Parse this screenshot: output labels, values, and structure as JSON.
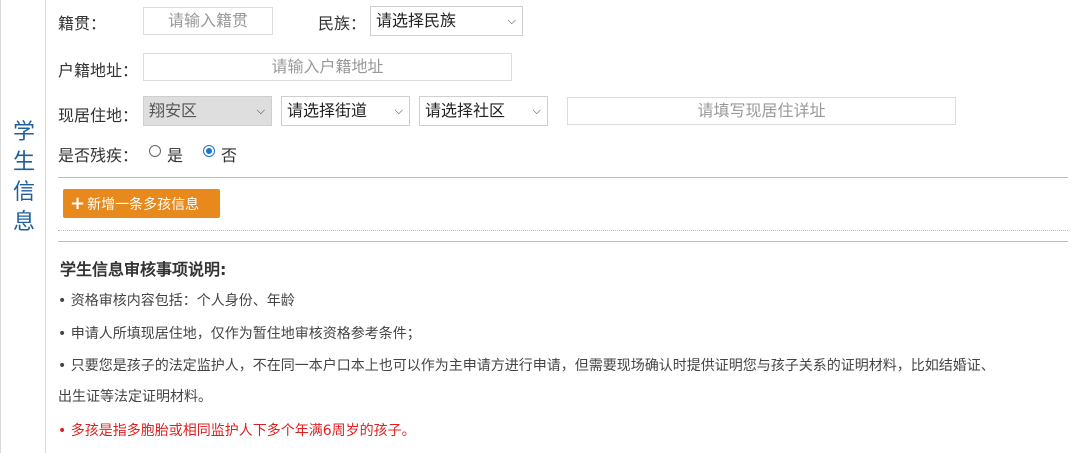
{
  "side": {
    "title_chars": [
      "学",
      "生",
      "信",
      "息"
    ]
  },
  "form": {
    "native_place": {
      "label": "籍贯：",
      "placeholder": "请输入籍贯"
    },
    "ethnicity": {
      "label": "民族：",
      "value": "请选择民族"
    },
    "household_address": {
      "label": "户籍地址：",
      "placeholder": "请输入户籍地址"
    },
    "current_address": {
      "label": "现居住地：",
      "district": "翔安区",
      "street": "请选择街道",
      "community": "请选择社区",
      "detail_placeholder": "请填写现居住详址"
    },
    "disability": {
      "label": "是否残疾：",
      "options": [
        "是",
        "否"
      ],
      "selected": "否"
    }
  },
  "add_button": {
    "plus": "+",
    "label": "新增一条多孩信息"
  },
  "notes": {
    "title": "学生信息审核事项说明:",
    "items": [
      "• 资格审核内容包括：个人身份、年龄",
      "• 申请人所填现居住地，仅作为暂住地审核资格参考条件；",
      "• 只要您是孩子的法定监护人，不在同一本户口本上也可以作为主申请方进行申请，但需要现场确认时提供证明您与孩子关系的证明材料，比如结婚证、",
      "出生证等法定证明材料。"
    ],
    "highlight": "• 多孩是指多胞胎或相同监护人下多个年满6周岁的孩子。"
  },
  "colors": {
    "accent_button": "#e8891d",
    "side_title": "#1f5f9a",
    "highlight_text": "#e02020",
    "radio_selected": "#1976d2"
  },
  "icons": {
    "select_chevron": "chevron-down-icon",
    "add": "plus-icon"
  }
}
